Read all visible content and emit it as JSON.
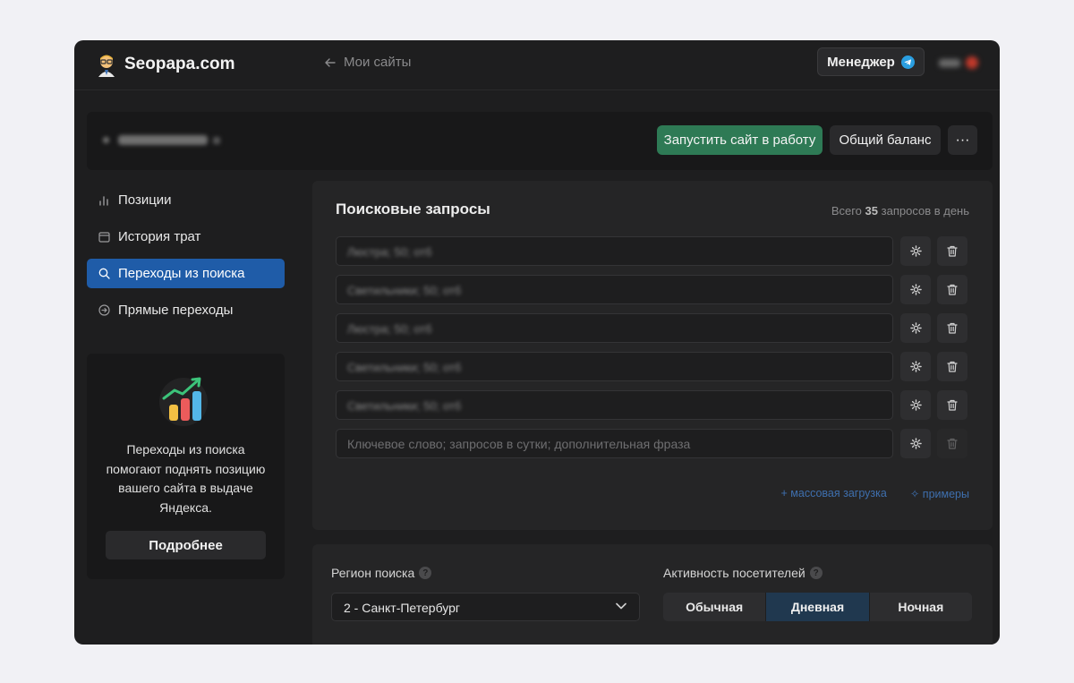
{
  "header": {
    "brand": "Seopapa.com",
    "back_label": "Мои сайты",
    "manager_label": "Менеджер"
  },
  "site": {
    "launch_label": "Запустить сайт в работу",
    "balance_label": "Общий баланс",
    "more_label": "···"
  },
  "sidebar": {
    "items": [
      {
        "label": "Позиции",
        "icon": "bar-chart-icon"
      },
      {
        "label": "История трат",
        "icon": "calendar-icon"
      },
      {
        "label": "Переходы из поиска",
        "icon": "search-icon",
        "active": true
      },
      {
        "label": "Прямые переходы",
        "icon": "arrow-circle-icon"
      }
    ],
    "promo": {
      "text": "Переходы из поиска помогают поднять позицию вашего сайта в выдаче Яндекса.",
      "button_label": "Подробнее"
    }
  },
  "queries": {
    "title": "Поисковые запросы",
    "total_prefix": "Всего",
    "total_count": "35",
    "total_suffix": "запросов в день",
    "rows": [
      {
        "text": "Люстра; 50; отб"
      },
      {
        "text": "Светильники; 50; отб"
      },
      {
        "text": "Люстра; 50; отб"
      },
      {
        "text": "Светильники; 50; отб"
      },
      {
        "text": "Светильники; 50; отб"
      }
    ],
    "placeholder": "Ключевое слово; запросов в сутки; дополнительная фраза",
    "bulk_upload": "+ массовая загрузка",
    "examples": "✧ примеры"
  },
  "settings": {
    "region_label": "Регион поиска",
    "region_value": "2 - Санкт-Петербург",
    "activity_label": "Активность посетителей",
    "activity_options": [
      "Обычная",
      "Дневная",
      "Ночная"
    ],
    "activity_selected": "Дневная"
  },
  "colors": {
    "accent_green": "#2e7a55",
    "nav_active": "#1f5ca8",
    "link_blue": "#3e6fae",
    "segment_active": "#20384f"
  }
}
